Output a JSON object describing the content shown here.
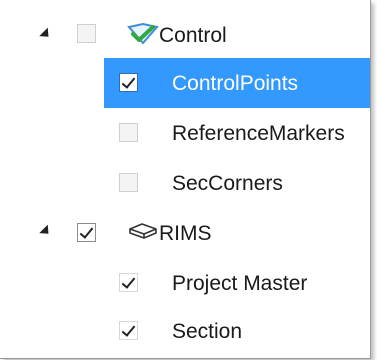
{
  "tree": {
    "nodes": [
      {
        "label": "Control",
        "checked": false,
        "expanded": true,
        "icon": "control-survey-icon",
        "children": [
          {
            "label": "ControlPoints",
            "checked": true,
            "selected": true
          },
          {
            "label": "ReferenceMarkers",
            "checked": false
          },
          {
            "label": "SecCorners",
            "checked": false
          }
        ]
      },
      {
        "label": "RIMS",
        "checked": true,
        "expanded": true,
        "icon": "database-layer-icon",
        "children": [
          {
            "label": "Project Master",
            "checked": true
          },
          {
            "label": "Section",
            "checked": true
          }
        ]
      }
    ]
  },
  "colors": {
    "selection": "#3399ff",
    "checkmark": "#222222",
    "control_icon_blue": "#3e8ed8",
    "control_icon_green": "#32a845"
  }
}
